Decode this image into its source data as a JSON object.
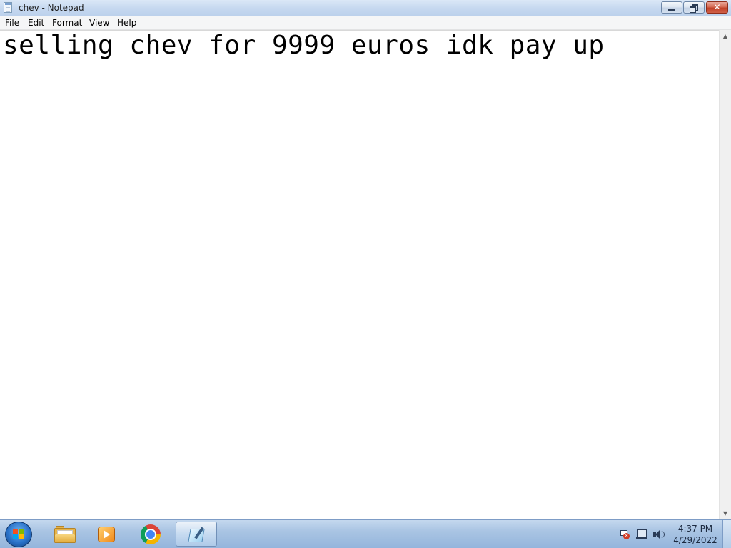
{
  "window": {
    "title": "chev - Notepad",
    "icon": "notepad-icon"
  },
  "menu": {
    "items": [
      "File",
      "Edit",
      "Format",
      "View",
      "Help"
    ]
  },
  "editor": {
    "content": "selling chev for 9999 euros idk pay up"
  },
  "window_controls": {
    "minimize_icon": "minimize-icon",
    "maximize_icon": "restore-icon",
    "close_symbol": "✕"
  },
  "scrollbar": {
    "up_arrow": "▲",
    "down_arrow": "▼"
  },
  "taskbar": {
    "pinned": [
      {
        "name": "windows-explorer",
        "icon": "folder-icon"
      },
      {
        "name": "windows-media-player",
        "icon": "media-player-icon"
      },
      {
        "name": "google-chrome",
        "icon": "chrome-icon"
      },
      {
        "name": "notepad",
        "icon": "notepad-icon",
        "active": true
      }
    ],
    "tray": {
      "icons": [
        "action-center-flag-icon",
        "network-icon",
        "volume-icon"
      ],
      "flag_badge": "✕"
    },
    "clock": {
      "time": "4:37 PM",
      "date": "4/29/2022"
    }
  },
  "colors": {
    "titlebar": "#c7d9f0",
    "close_button": "#c1432a",
    "taskbar": "#a9c4e3"
  }
}
